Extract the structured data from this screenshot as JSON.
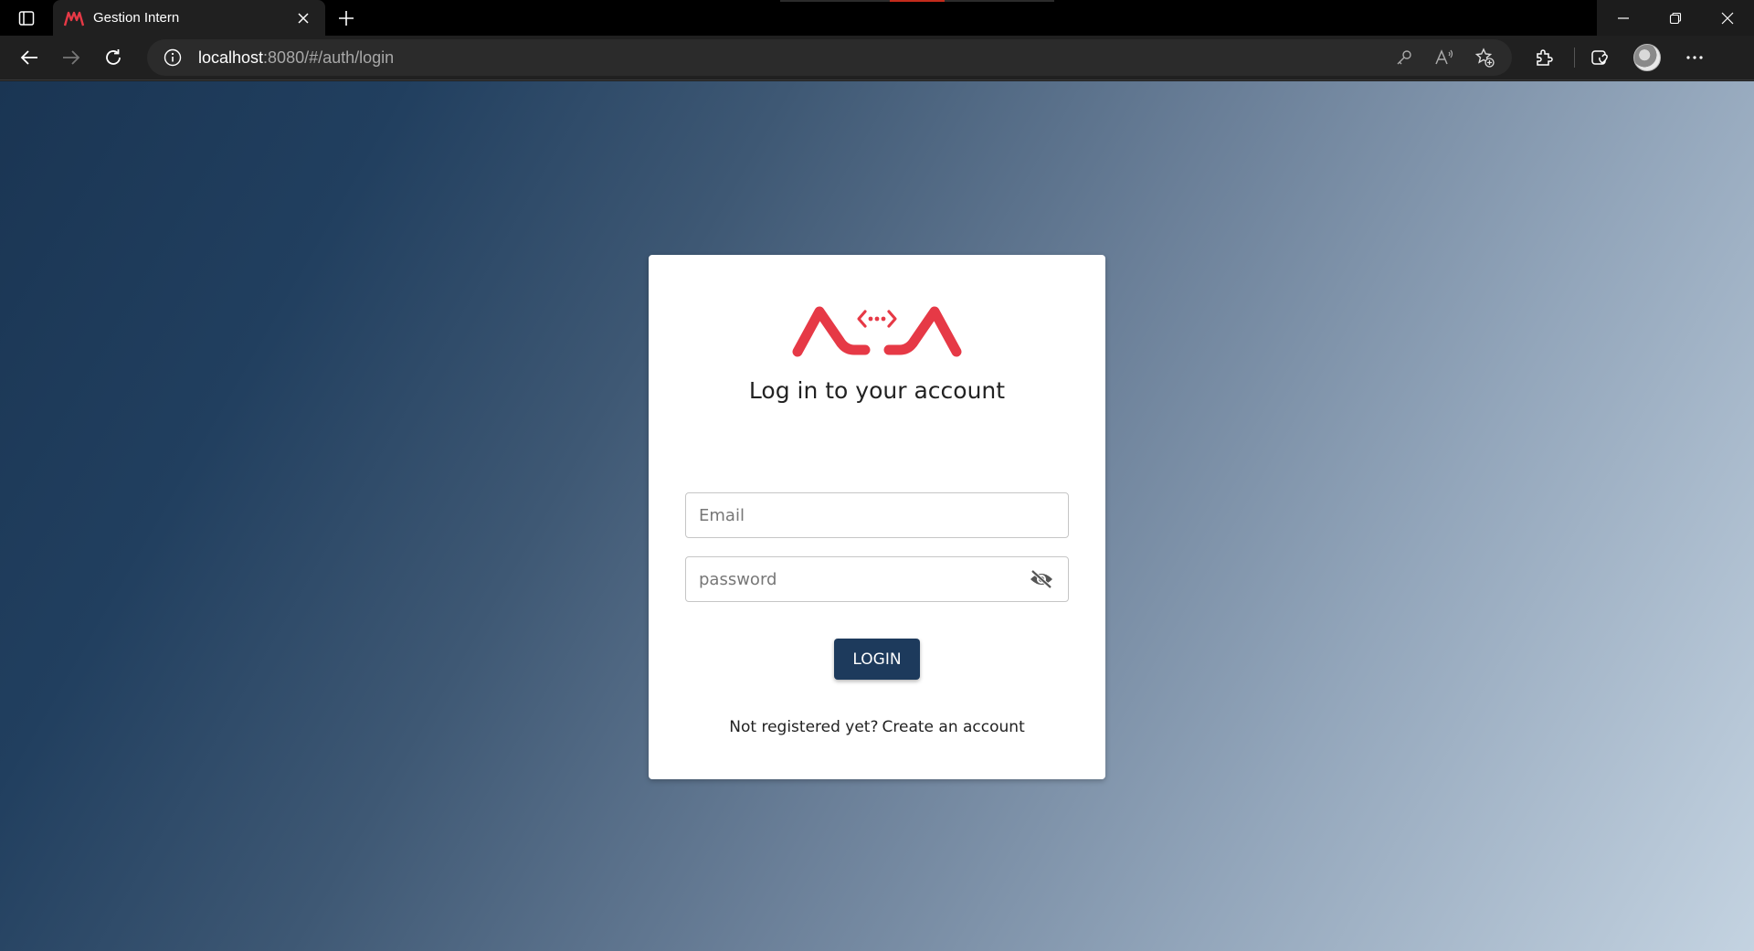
{
  "browser": {
    "tab": {
      "title": "Gestion Intern"
    },
    "address": {
      "host": "localhost",
      "rest": ":8080/#/auth/login"
    },
    "colors": {
      "brand": "#e63946"
    }
  },
  "login": {
    "heading": "Log in to your account",
    "email_placeholder": "Email",
    "password_placeholder": "password",
    "login_label": "LOGIN",
    "register_question": "Not registered yet?",
    "register_link": "Create an account",
    "colors": {
      "button": "#1d3a5c",
      "logo": "#e63946"
    }
  }
}
